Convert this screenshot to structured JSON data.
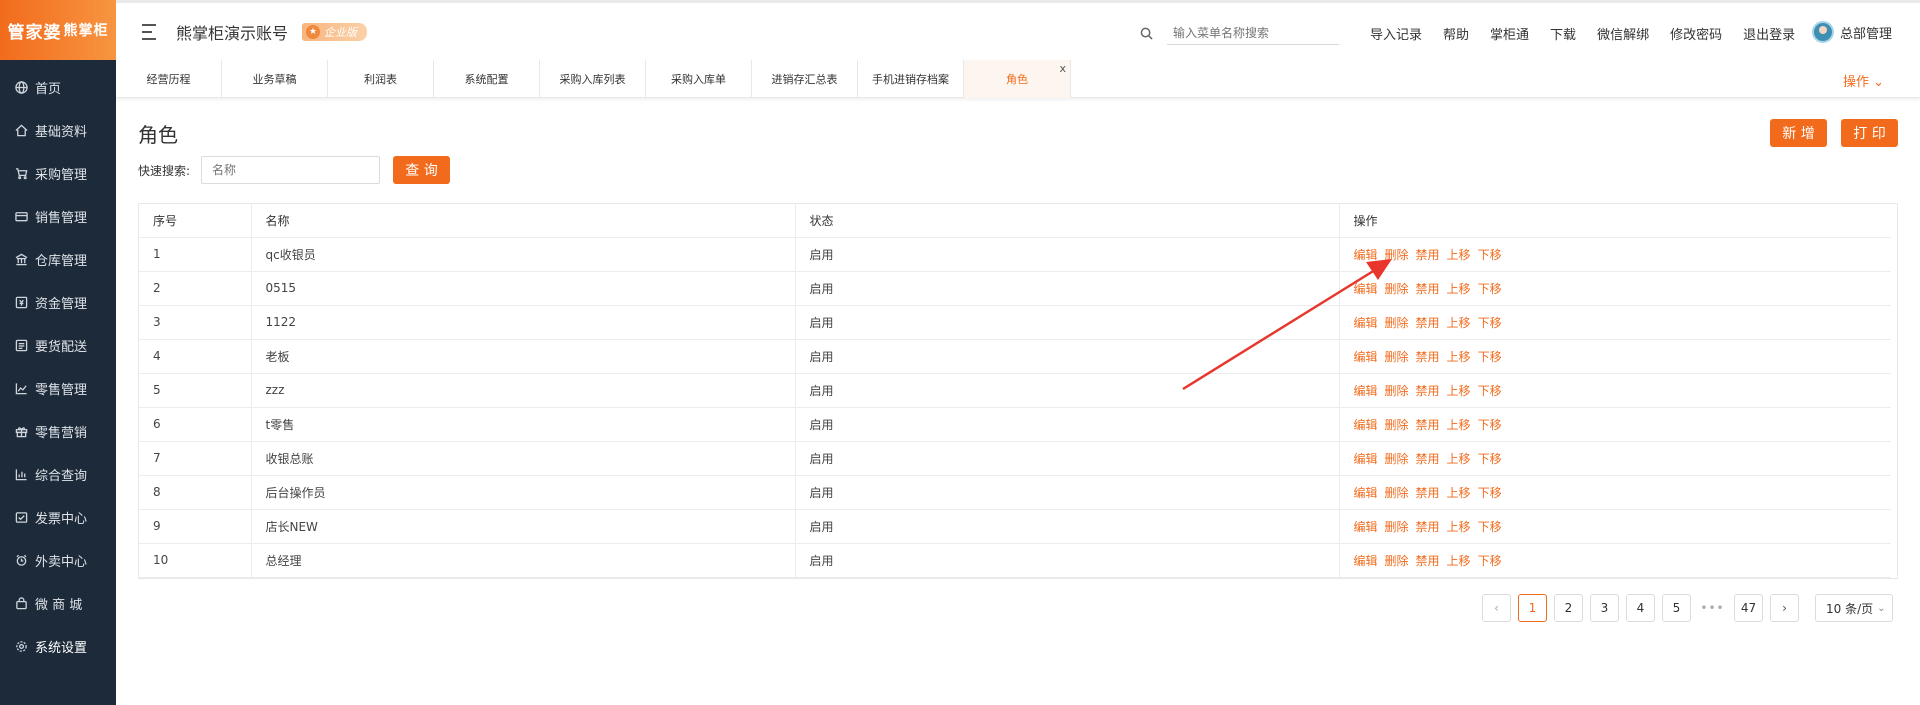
{
  "logo": {
    "main": "管家婆",
    "sub": "熊掌柜"
  },
  "sidebar": {
    "items": [
      {
        "label": "首页",
        "icon": "globe-icon"
      },
      {
        "label": "基础资料",
        "icon": "home-icon"
      },
      {
        "label": "采购管理",
        "icon": "cart-icon"
      },
      {
        "label": "销售管理",
        "icon": "card-icon"
      },
      {
        "label": "仓库管理",
        "icon": "warehouse-icon"
      },
      {
        "label": "资金管理",
        "icon": "money-icon"
      },
      {
        "label": "要货配送",
        "icon": "list-icon"
      },
      {
        "label": "零售管理",
        "icon": "chart-icon"
      },
      {
        "label": "零售营销",
        "icon": "gift-icon"
      },
      {
        "label": "综合查询",
        "icon": "bar-chart-icon"
      },
      {
        "label": "发票中心",
        "icon": "invoice-icon"
      },
      {
        "label": "外卖中心",
        "icon": "alarm-icon"
      },
      {
        "label": "微 商 城",
        "icon": "bag-icon"
      },
      {
        "label": "系统设置",
        "icon": "gear-icon"
      }
    ]
  },
  "header": {
    "account": "熊掌柜演示账号",
    "badge": "企业版",
    "search_placeholder": "输入菜单名称搜索",
    "links": [
      "导入记录",
      "帮助",
      "掌柜通",
      "下载",
      "微信解绑",
      "修改密码",
      "退出登录"
    ],
    "user": "总部管理"
  },
  "tabs": [
    "经营历程",
    "业务草稿",
    "利润表",
    "系统配置",
    "采购入库列表",
    "采购入库单",
    "进销存汇总表",
    "手机进销存档案",
    "角色"
  ],
  "tab_close": "x",
  "ops_label": "操作",
  "page": {
    "title": "角色",
    "add_label": "新 增",
    "print_label": "打 印",
    "quick_search_label": "快速搜索:",
    "quick_search_placeholder": "名称",
    "query_label": "查 询"
  },
  "table": {
    "headers": [
      "序号",
      "名称",
      "状态",
      "操作"
    ],
    "actions": [
      "编辑",
      "删除",
      "禁用",
      "上移",
      "下移"
    ],
    "rows": [
      {
        "no": "1",
        "name": "qc收银员",
        "status": "启用"
      },
      {
        "no": "2",
        "name": "0515",
        "status": "启用"
      },
      {
        "no": "3",
        "name": "1122",
        "status": "启用"
      },
      {
        "no": "4",
        "name": "老板",
        "status": "启用"
      },
      {
        "no": "5",
        "name": "zzz",
        "status": "启用"
      },
      {
        "no": "6",
        "name": "t零售",
        "status": "启用"
      },
      {
        "no": "7",
        "name": "收银总账",
        "status": "启用"
      },
      {
        "no": "8",
        "name": "后台操作员",
        "status": "启用"
      },
      {
        "no": "9",
        "name": "店长NEW",
        "status": "启用"
      },
      {
        "no": "10",
        "name": "总经理",
        "status": "启用"
      }
    ]
  },
  "pagination": {
    "pages": [
      "1",
      "2",
      "3",
      "4",
      "5"
    ],
    "ellipsis": "•••",
    "last": "47",
    "current": "1",
    "page_size": "10 条/页"
  },
  "colors": {
    "accent": "#f26b1d",
    "sidebar_bg": "#1d2a3a",
    "annotation_arrow": "#e8362d"
  }
}
